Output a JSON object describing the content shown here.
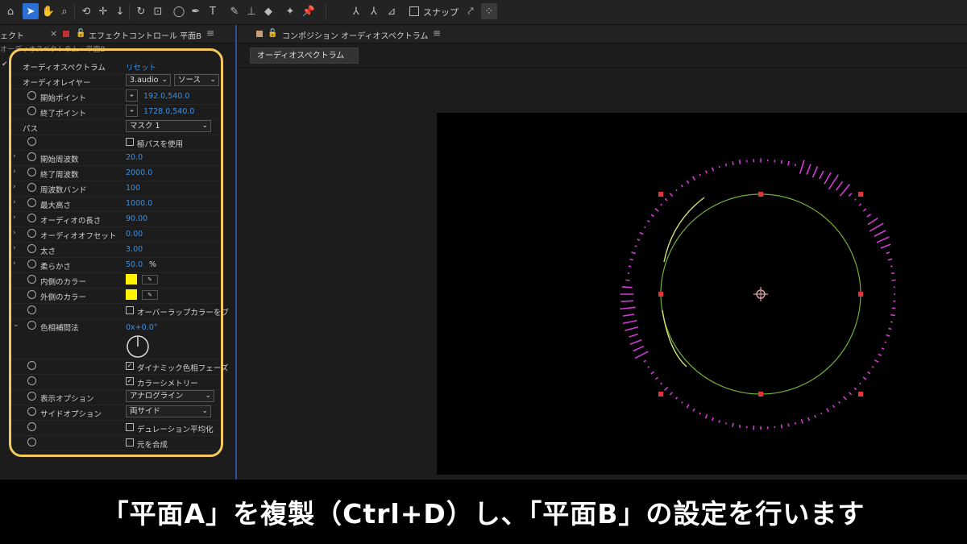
{
  "toolbar": {
    "icons": [
      "home-icon",
      "selection-arrow-icon",
      "hand-icon",
      "zoom-icon",
      "orbit-icon",
      "pan-icon",
      "dolly-icon",
      "rotate-icon",
      "pan-behind-icon",
      "ellipse-icon",
      "pen-icon",
      "type-icon",
      "brush-icon",
      "clone-stamp-icon",
      "eraser-icon",
      "roto-brush-icon",
      "puppet-pin-icon"
    ],
    "snap_label": "スナップ"
  },
  "effects_panel": {
    "tab_left_fragment": "ェクト",
    "tab_title": "エフェクトコントロール 平面B",
    "sub_label": "オーディオスペクトラム・平面B",
    "effect_name": "オーディオスペクトラム",
    "reset_label": "リセット",
    "rows": [
      {
        "name": "オーディオレイヤー",
        "dropdown1": "3.audio",
        "dropdown2": "ソース"
      },
      {
        "name": "開始ポイント",
        "value": "192.0,540.0"
      },
      {
        "name": "終了ポイント",
        "value": "1728.0,540.0"
      },
      {
        "name": "パス",
        "dropdown": "マスク 1"
      },
      {
        "checkbox_label": "極パスを使用",
        "checked": false
      },
      {
        "name": "開始周波数",
        "value": "20.0"
      },
      {
        "name": "終了周波数",
        "value": "2000.0"
      },
      {
        "name": "周波数バンド",
        "value": "100"
      },
      {
        "name": "最大高さ",
        "value": "1000.0"
      },
      {
        "name": "オーディオの長さ",
        "value": "90.00"
      },
      {
        "name": "オーディオオフセット",
        "value": "0.00"
      },
      {
        "name": "太さ",
        "value": "3.00"
      },
      {
        "name": "柔らかさ",
        "value": "50.0",
        "unit": "%"
      },
      {
        "name": "内側のカラー",
        "color": "#fff200"
      },
      {
        "name": "外側のカラー",
        "color": "#fff200"
      },
      {
        "checkbox_label": "オーバーラップカラーをブ",
        "checked": false
      },
      {
        "name": "色相補間法",
        "value": "0x+0.0°"
      },
      {
        "checkbox_label": "ダイナミック色相フェーズ",
        "checked": true
      },
      {
        "checkbox_label": "カラーシメトリー",
        "checked": true
      },
      {
        "name": "表示オプション",
        "dropdown": "アナログライン"
      },
      {
        "name": "サイドオプション",
        "dropdown": "両サイド"
      },
      {
        "checkbox_label": "デュレーション平均化",
        "checked": false
      },
      {
        "checkbox_label": "元を合成",
        "checked": false
      }
    ]
  },
  "composition_panel": {
    "tab_title": "コンポジション オーディオスペクトラム",
    "comp_button": "オーディオスペクトラム"
  },
  "colors": {
    "highlight": "#f5c95c",
    "accent": "#3d8fe0",
    "spectrum_outer": "#d23bd6",
    "spectrum_inner": "#cfe07a",
    "mask_path": "#6fae3a",
    "handle": "#e0343a"
  },
  "caption": "「平面A」を複製（Ctrl+D）し、「平面B」の設定を行います"
}
